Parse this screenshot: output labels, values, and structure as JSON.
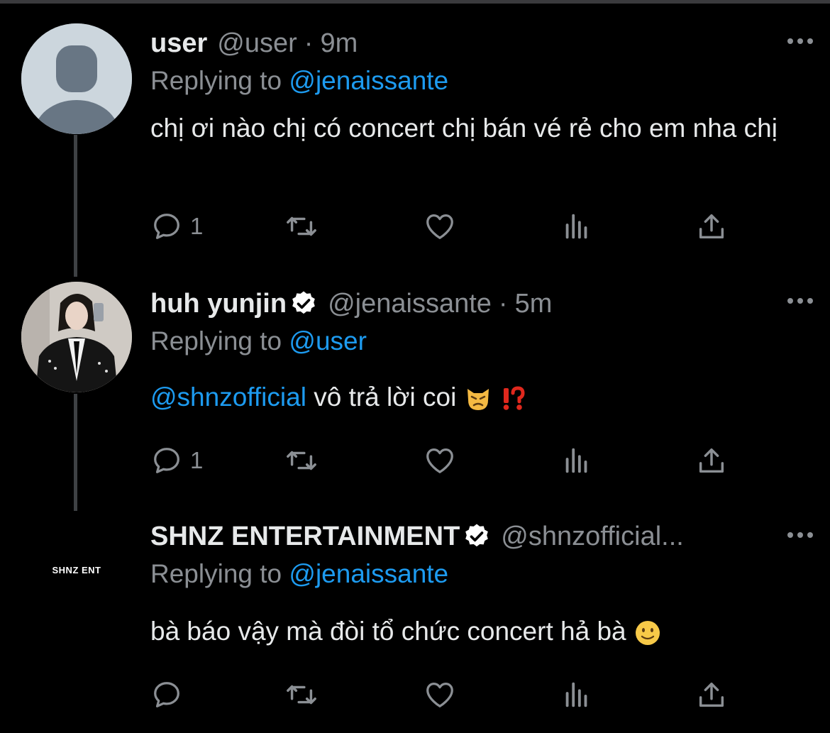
{
  "tweets": [
    {
      "name": "user",
      "handle": "@user",
      "separator": "·",
      "time": "9m",
      "replying_prefix": "Replying to",
      "replying_to": "@jenaissante",
      "text": "chị ơi nào chị có concert chị bán vé rẻ cho em nha chị",
      "reply_count": "1",
      "verified": false
    },
    {
      "name": "huh yunjin",
      "handle": "@jenaissante",
      "separator": "·",
      "time": "5m",
      "replying_prefix": "Replying to",
      "replying_to": "@user",
      "text_mention": "@shnzofficial",
      "text": "vô trả lời coi",
      "reply_count": "1",
      "verified": true,
      "emojis": [
        "pouting-cat-emoji",
        "exclamation-question-emoji"
      ]
    },
    {
      "name": "SHNZ ENTERTAINMENT",
      "handle": "@shnzofficial...",
      "avatar_text": "SHNZ ENT",
      "replying_prefix": "Replying to",
      "replying_to": "@jenaissante",
      "text": "bà báo vậy mà đòi tổ chức concert hả bà",
      "verified": true,
      "emojis": [
        "slight-smile-emoji"
      ]
    }
  ],
  "icons": [
    "reply-icon",
    "retweet-icon",
    "like-icon",
    "analytics-icon",
    "share-icon",
    "more-icon",
    "verified-badge-icon"
  ],
  "colors": {
    "background": "#000000",
    "text": "#e7e9ea",
    "muted": "#8b8f94",
    "accent": "#1d9bf0",
    "thread": "#3e4144"
  }
}
